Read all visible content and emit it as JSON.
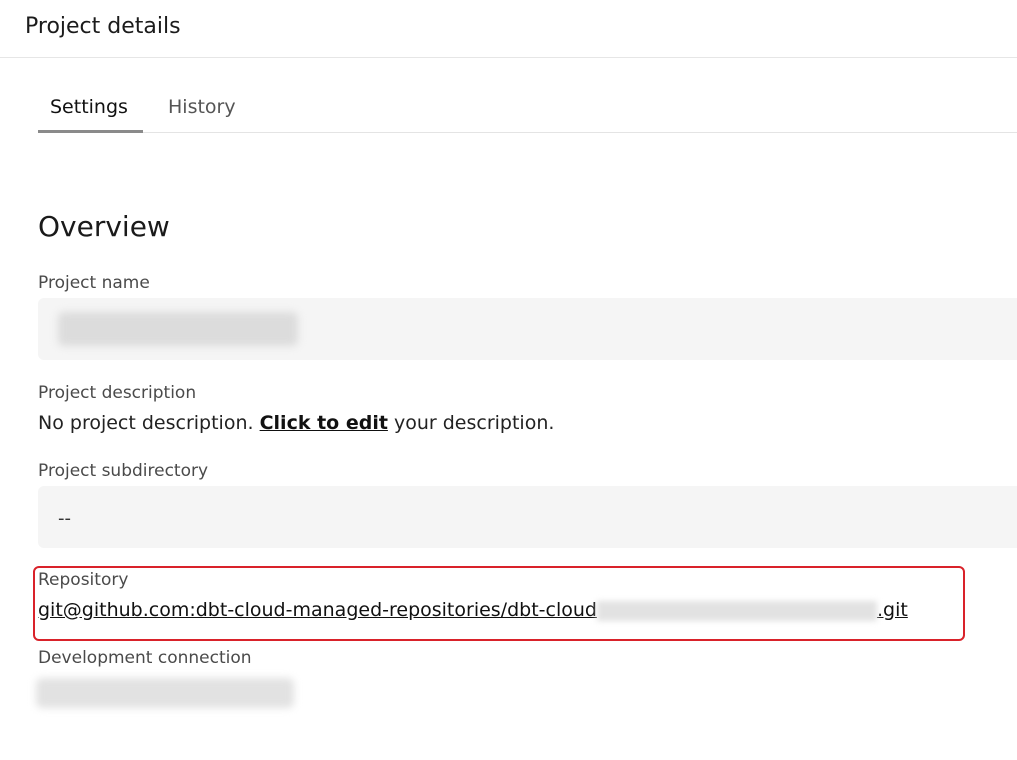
{
  "header": {
    "title": "Project details"
  },
  "tabs": [
    {
      "label": "Settings",
      "active": true
    },
    {
      "label": "History",
      "active": false
    }
  ],
  "overview": {
    "title": "Overview",
    "project_name": {
      "label": "Project name"
    },
    "project_description": {
      "label": "Project description",
      "text_before": "No project description. ",
      "link": "Click to edit",
      "text_after": " your description."
    },
    "project_subdirectory": {
      "label": "Project subdirectory",
      "value": "--"
    },
    "repository": {
      "label": "Repository",
      "prefix": "git@github.com:dbt-cloud-managed-repositories/dbt-cloud",
      "suffix": ".git"
    },
    "development_connection": {
      "label": "Development connection"
    }
  },
  "colors": {
    "highlight": "#d9222a",
    "field_bg": "#f5f5f5"
  }
}
